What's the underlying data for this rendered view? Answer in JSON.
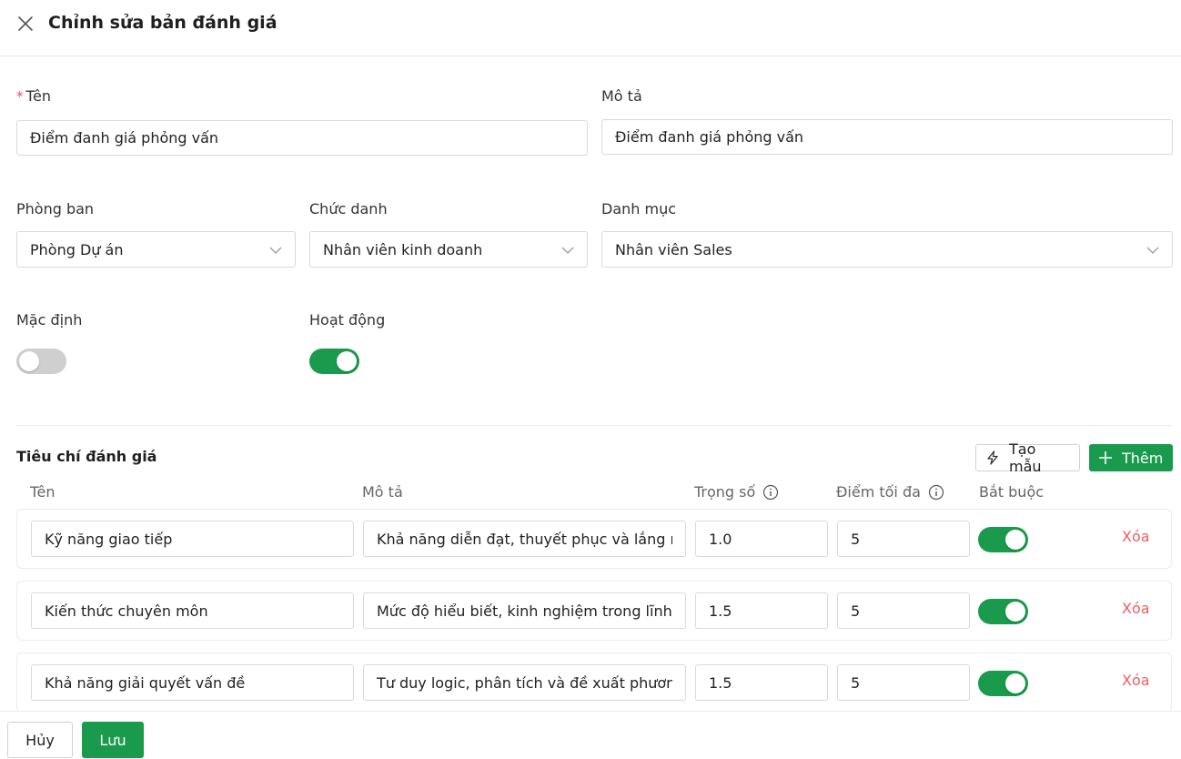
{
  "header": {
    "title": "Chỉnh sửa bản đánh giá"
  },
  "form": {
    "name": {
      "label": "Tên",
      "required_mark": "*",
      "value": "Điểm đanh giá phỏng vấn"
    },
    "description": {
      "label": "Mô tả",
      "value": "Điểm đanh giá phỏng vấn"
    },
    "department": {
      "label": "Phòng ban",
      "value": "Phòng Dự án"
    },
    "position": {
      "label": "Chức danh",
      "value": "Nhân viên kinh doanh"
    },
    "category": {
      "label": "Danh mục",
      "value": "Nhân viên Sales"
    },
    "default": {
      "label": "Mặc định",
      "on": false
    },
    "active": {
      "label": "Hoạt động",
      "on": true
    }
  },
  "criteria": {
    "title": "Tiêu chí đánh giá",
    "template_label": "Tạo mẫu",
    "add_label": "Thêm",
    "columns": {
      "name": "Tên",
      "description": "Mô tả",
      "weight": "Trọng số",
      "max_score": "Điểm tối đa",
      "required": "Bắt buộc"
    },
    "delete_label": "Xóa",
    "rows": [
      {
        "name": "Kỹ năng giao tiếp",
        "description": "Khả năng diễn đạt, thuyết phục và lắng nghe",
        "weight": "1.0",
        "max_score": "5",
        "required": true
      },
      {
        "name": "Kiến thức chuyên môn",
        "description": "Mức độ hiểu biết, kinh nghiệm trong lĩnh vực",
        "weight": "1.5",
        "max_score": "5",
        "required": true
      },
      {
        "name": "Khả năng giải quyết vấn đề",
        "description": "Tư duy logic, phân tích và đề xuất phương án",
        "weight": "1.5",
        "max_score": "5",
        "required": true
      }
    ]
  },
  "footer": {
    "cancel_label": "Hủy",
    "save_label": "Lưu"
  },
  "colors": {
    "accent": "#1a9a4c",
    "danger": "#ef5c5c",
    "toggle_off": "#cfcfcf"
  }
}
